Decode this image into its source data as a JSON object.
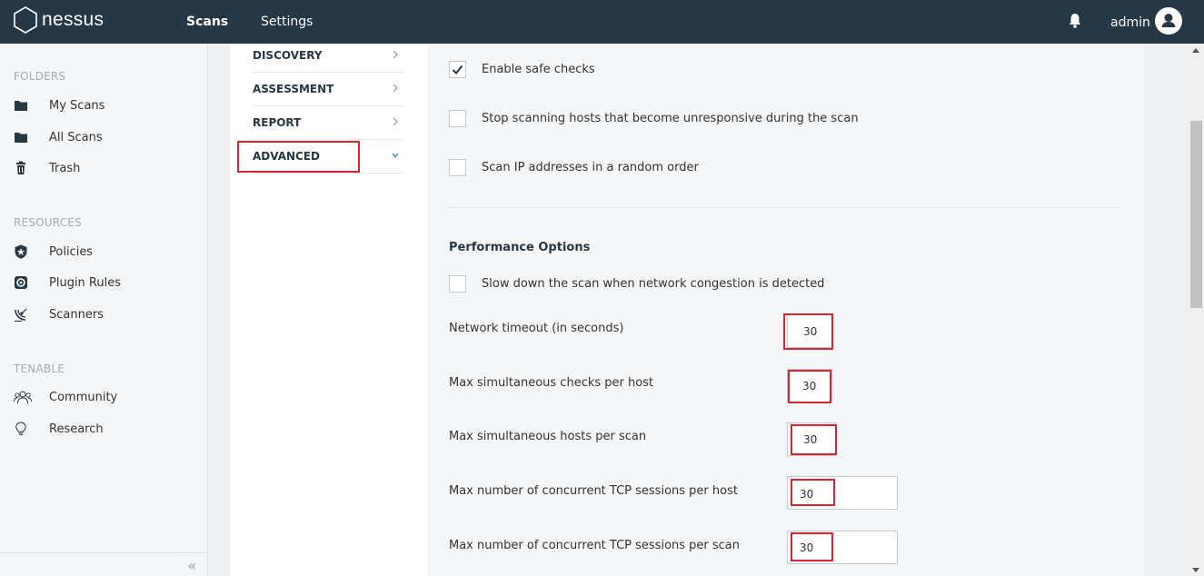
{
  "header": {
    "brand": "nessus",
    "nav": {
      "scans": "Scans",
      "settings": "Settings"
    },
    "user": "admin",
    "icons": {
      "logo": "nessus-hexagon-logo",
      "notifications": "bell-icon",
      "avatar": "user-avatar-icon"
    }
  },
  "sidebar": {
    "folders_title": "FOLDERS",
    "folders": [
      {
        "label": "My Scans",
        "icon": "folder-icon"
      },
      {
        "label": "All Scans",
        "icon": "folder-icon"
      },
      {
        "label": "Trash",
        "icon": "trash-icon"
      }
    ],
    "resources_title": "RESOURCES",
    "resources": [
      {
        "label": "Policies",
        "icon": "shield-star-icon"
      },
      {
        "label": "Plugin Rules",
        "icon": "plugin-rules-icon"
      },
      {
        "label": "Scanners",
        "icon": "satellite-dish-icon"
      }
    ],
    "tenable_title": "TENABLE",
    "tenable": [
      {
        "label": "Community",
        "icon": "community-icon"
      },
      {
        "label": "Research",
        "icon": "lightbulb-icon"
      }
    ],
    "collapse": "«"
  },
  "subnav": {
    "items": [
      {
        "label": "DISCOVERY"
      },
      {
        "label": "ASSESSMENT"
      },
      {
        "label": "REPORT"
      },
      {
        "label": "ADVANCED"
      }
    ]
  },
  "options": {
    "safe_checks": {
      "label": "Enable safe checks",
      "checked": true
    },
    "stop_unresponsive": {
      "label": "Stop scanning hosts that become unresponsive during the scan",
      "checked": false
    },
    "random_order": {
      "label": "Scan IP addresses in a random order",
      "checked": false
    }
  },
  "performance": {
    "title": "Performance Options",
    "slow_down": {
      "label": "Slow down the scan when network congestion is detected",
      "checked": false
    },
    "fields": [
      {
        "label": "Network timeout (in seconds)",
        "value": "30"
      },
      {
        "label": "Max simultaneous checks per host",
        "value": "30"
      },
      {
        "label": "Max simultaneous hosts per scan",
        "value": "30"
      },
      {
        "label": "Max number of concurrent TCP sessions per host",
        "value": "30"
      },
      {
        "label": "Max number of concurrent TCP sessions per scan",
        "value": "30"
      }
    ]
  },
  "colors": {
    "topbar": "#263746",
    "highlight": "#d9252f",
    "accent": "#3c8dbc"
  }
}
